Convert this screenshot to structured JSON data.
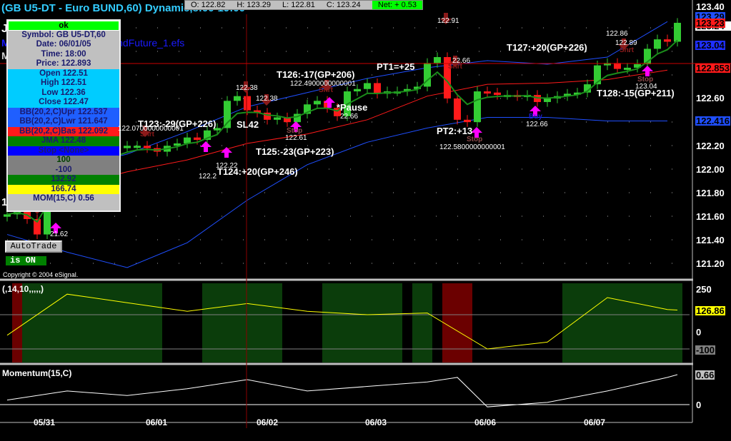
{
  "window": {
    "title": "(GB U5-DT - Euro BUND,60) Dynamic,8:00-19:00"
  },
  "ohlc_bar": {
    "open": "O: 122.82",
    "high": "H: 123.29",
    "low": "L: 122.81",
    "close": "C: 123.24",
    "net": "Net: + 0.53"
  },
  "study_labels": {
    "efs": "BundFuture_1.efs",
    "j": "J",
    "m1": "M",
    "m2": "M"
  },
  "data_window": {
    "status": "ok",
    "symbol": "Symbol: GB U5-DT,60",
    "date": "Date: 06/01/05",
    "time": "Time: 18:00",
    "price": "Price: 122.893",
    "open": "Open 122.51",
    "high": "High 122.51",
    "low": "Low 122.36",
    "close": "Close 122.47",
    "bb_upr": "BB(20,2,C)Upr 122.537",
    "bb_lwr": "BB(20,2,C)Lwr 121.647",
    "bb_bas": "BB(20,2,C)Bas 122.092",
    "jma": "JMA 122.48",
    "stop": "Stop <None>",
    "v100": "100",
    "vm100": "-100",
    "v13292": "132.92",
    "v16674": "166.74",
    "mom": "MOM(15,C) 0.56"
  },
  "buttons": {
    "autotrade": "AutoTrade",
    "is_on": "is ON"
  },
  "copyright": "Copyright © 2004 eSignal.",
  "annotations": [
    "T123:-29(GP+226)",
    "T124:+20(GP+246)",
    "T125:-23(GP+223)",
    "T126:-17(GP+206)",
    "PT1=+25",
    "*Pause",
    "SL42",
    "PT2:+13",
    "T127:+20(GP+226)",
    "T128:-15(GP+211)"
  ],
  "small_labels": [
    "122.38",
    "122.38",
    "122.2",
    "122.22",
    "122.91",
    "22.66",
    "122.61",
    "122.4900000000001",
    "22.66",
    "122.0700000000001",
    "122.91",
    "122.5800000000001",
    "122.66",
    "122.86",
    "122.89",
    "123.04",
    "21.62",
    "1"
  ],
  "signals": {
    "short": "Shrt",
    "stop": "Stop",
    "buy": "Buy"
  },
  "osc_title": "(,14,10,,,,,)",
  "mom_title": "Momentum(15,C)",
  "price_axis": {
    "ticks": [
      "123.40",
      "122.60",
      "122.20",
      "122.00",
      "121.80",
      "121.60",
      "121.40",
      "121.20"
    ],
    "markers": [
      {
        "text": "123.29",
        "color": "#1f4fff"
      },
      {
        "text": "123.24",
        "color": "#ffffff"
      },
      {
        "text": "123.23",
        "color": "#ff1a1a"
      },
      {
        "text": "123.04",
        "color": "#1f2fff"
      },
      {
        "text": "122.853",
        "color": "#ff1a1a"
      },
      {
        "text": "122.416",
        "color": "#1f4fff"
      }
    ]
  },
  "osc_axis": {
    "ticks": [
      "250",
      "0"
    ],
    "markers": [
      {
        "text": "126.86",
        "color": "#ffff00"
      },
      {
        "text": "-100",
        "color": "#808080"
      }
    ]
  },
  "mom_axis": {
    "ticks": [
      "0"
    ],
    "markers": [
      {
        "text": "0.66",
        "color": "#c0c0c0"
      }
    ]
  },
  "dates": [
    "05/31",
    "06/01",
    "06/02",
    "06/03",
    "06/06",
    "06/07"
  ],
  "colors": {
    "up": "#33cc33",
    "down": "#ff1a1a",
    "bb": "#1f4fff",
    "basis": "#ff1a1a",
    "jma": "#1a8c1a",
    "osc_green": "#0b3d0b",
    "osc_red": "#6b0000"
  },
  "chart_data": [
    {
      "type": "candlestick",
      "title": "GB U5-DT Euro BUND 60",
      "ylim": [
        121.1,
        123.42
      ],
      "closes": [
        121.62,
        121.66,
        121.58,
        121.45,
        121.95,
        122.0,
        122.05,
        122.08,
        122.1,
        122.12,
        122.15,
        122.18,
        122.2,
        122.2,
        122.18,
        122.15,
        122.2,
        122.22,
        122.27,
        122.25,
        122.33,
        122.35,
        122.58,
        122.62,
        122.5,
        122.48,
        122.42,
        122.44,
        122.4,
        122.47,
        122.55,
        122.58,
        122.52,
        122.45,
        122.66,
        122.68,
        122.73,
        122.64,
        122.66,
        122.66,
        122.68,
        122.7,
        122.9,
        122.95,
        122.6,
        122.42,
        122.4,
        122.66,
        122.65,
        122.63,
        122.63,
        122.62,
        122.63,
        122.57,
        122.6,
        122.62,
        122.64,
        122.65,
        122.72,
        122.88,
        122.9,
        122.85,
        122.86,
        122.89,
        123.02,
        123.1,
        123.08,
        123.24
      ],
      "sample_bars": [
        0,
        6,
        12,
        18,
        24,
        30,
        36,
        42,
        48,
        54,
        60,
        66
      ],
      "bb_upper": [
        121.95,
        122.0,
        122.13,
        122.32,
        122.53,
        122.65,
        122.77,
        122.86,
        122.92,
        122.89,
        122.95,
        123.25
      ],
      "bb_basis": [
        121.72,
        121.85,
        121.98,
        122.08,
        122.22,
        122.3,
        122.42,
        122.62,
        122.72,
        122.73,
        122.76,
        122.84
      ],
      "bb_lower": [
        121.45,
        121.3,
        121.17,
        121.38,
        121.74,
        122.04,
        122.23,
        122.35,
        122.44,
        122.44,
        122.41,
        122.41
      ]
    },
    {
      "type": "line",
      "title": "(,14,10,,,,,)",
      "ylim": [
        -130,
        290
      ],
      "sample_bars": [
        0,
        6,
        12,
        18,
        24,
        30,
        36,
        42,
        48,
        54,
        60,
        66,
        67
      ],
      "values": [
        -20,
        220,
        170,
        120,
        165,
        120,
        100,
        110,
        -100,
        -60,
        200,
        130,
        126.86
      ],
      "zones": [
        {
          "from": 1,
          "to": 2,
          "signal": "red"
        },
        {
          "from": 2,
          "to": 16,
          "signal": "green"
        },
        {
          "from": 20,
          "to": 28,
          "signal": "green"
        },
        {
          "from": 32,
          "to": 40,
          "signal": "green"
        },
        {
          "from": 41,
          "to": 43,
          "signal": "green"
        },
        {
          "from": 44,
          "to": 47,
          "signal": "red"
        },
        {
          "from": 56,
          "to": 68,
          "signal": "green"
        }
      ],
      "levels": [
        100,
        -100
      ]
    },
    {
      "type": "line",
      "title": "Momentum(15,C)",
      "ylim": [
        -0.4,
        0.8
      ],
      "sample_bars": [
        0,
        6,
        12,
        18,
        24,
        30,
        36,
        42,
        45,
        48,
        54,
        60,
        66,
        67
      ],
      "values": [
        0.1,
        0.3,
        0.2,
        0.35,
        0.55,
        0.3,
        0.4,
        0.5,
        0.6,
        -0.05,
        0.05,
        0.3,
        0.6,
        0.66
      ]
    }
  ]
}
